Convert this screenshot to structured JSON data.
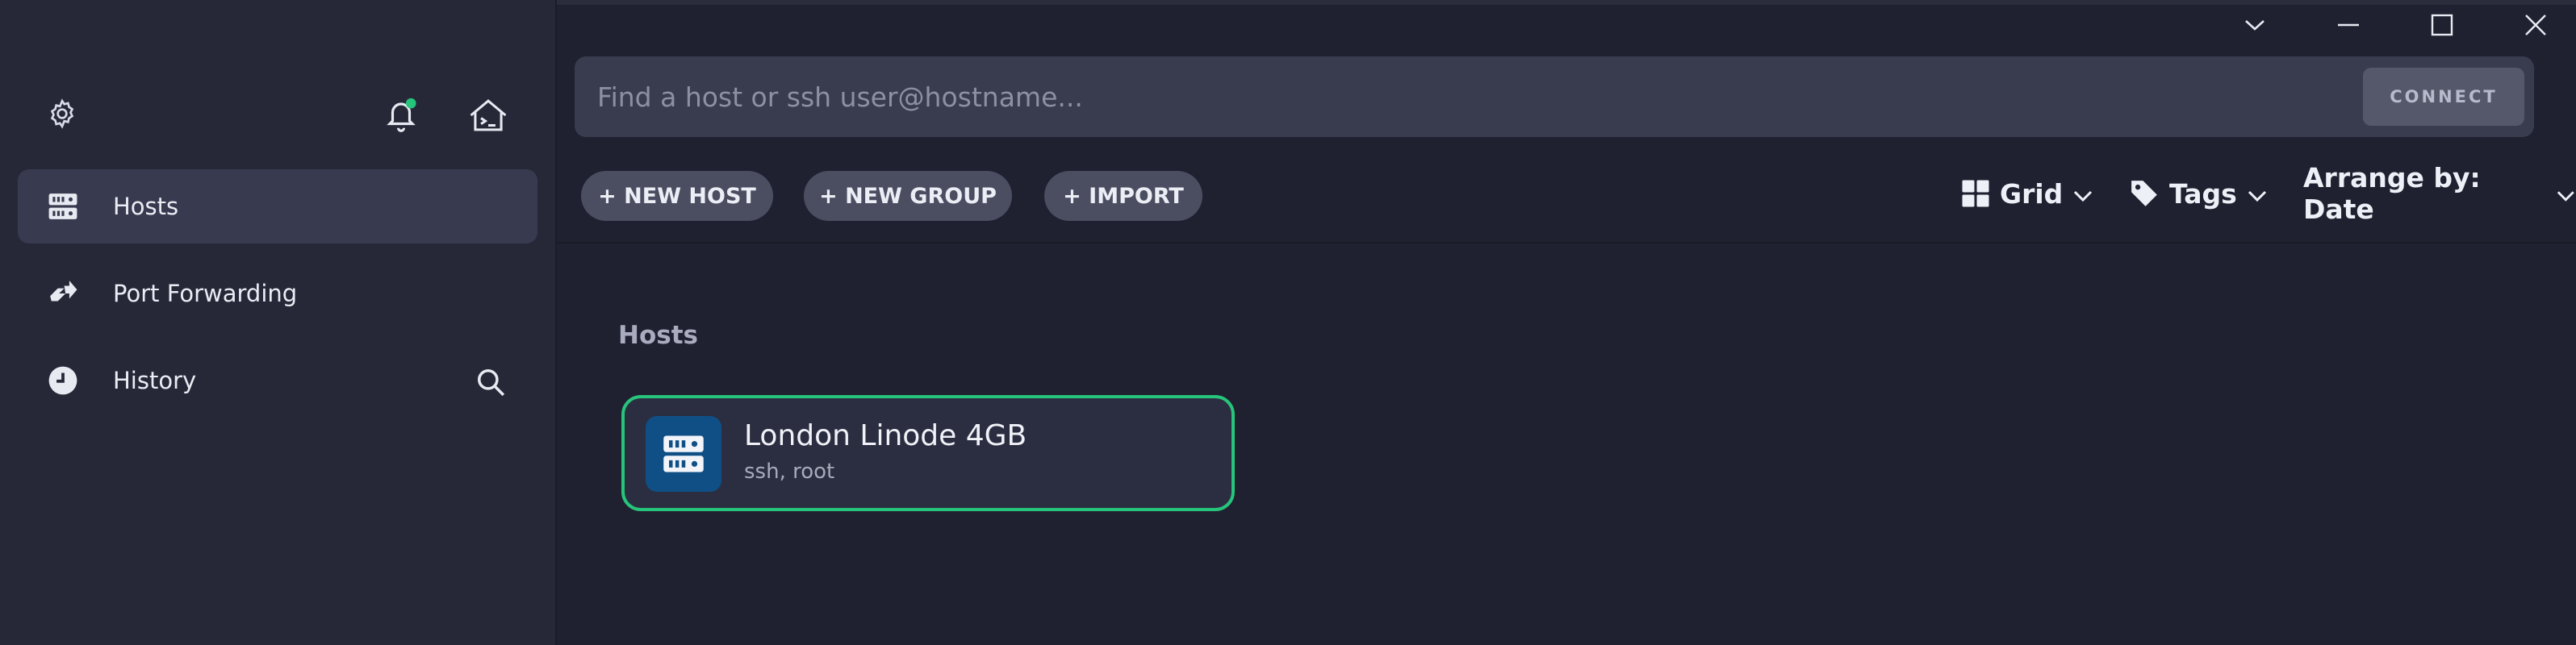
{
  "sidebar": {
    "settings_icon": "gear-icon",
    "notifications_icon": "bell-icon",
    "notification_dot_color": "#27c47b",
    "terminal_icon": "terminal-home-icon",
    "items": [
      {
        "label": "Hosts",
        "icon": "server-icon",
        "active": true
      },
      {
        "label": "Port Forwarding",
        "icon": "port-forward-icon",
        "active": false
      },
      {
        "label": "History",
        "icon": "clock-icon",
        "active": false
      }
    ],
    "history_search_icon": "search-icon"
  },
  "window_controls": {
    "dropdown": "chevron-down-icon",
    "minimize": "minimize-icon",
    "maximize": "maximize-icon",
    "close": "close-icon"
  },
  "search": {
    "placeholder": "Find a host or ssh user@hostname...",
    "value": "",
    "connect_label": "CONNECT"
  },
  "toolbar": {
    "new_host_label": "+ NEW HOST",
    "new_group_label": "+ NEW GROUP",
    "import_label": "+ IMPORT",
    "view_label": "Grid",
    "tags_label": "Tags",
    "arrange_label": "Arrange by: Date"
  },
  "hosts_section": {
    "title": "Hosts",
    "hosts": [
      {
        "name": "London Linode 4GB",
        "details": "ssh, root",
        "icon": "server-icon",
        "selected": true
      }
    ]
  },
  "colors": {
    "accent_green": "#27c47b",
    "host_icon_bg": "#0f4f86",
    "sidebar_bg": "#262838",
    "main_bg": "#1f2130"
  }
}
